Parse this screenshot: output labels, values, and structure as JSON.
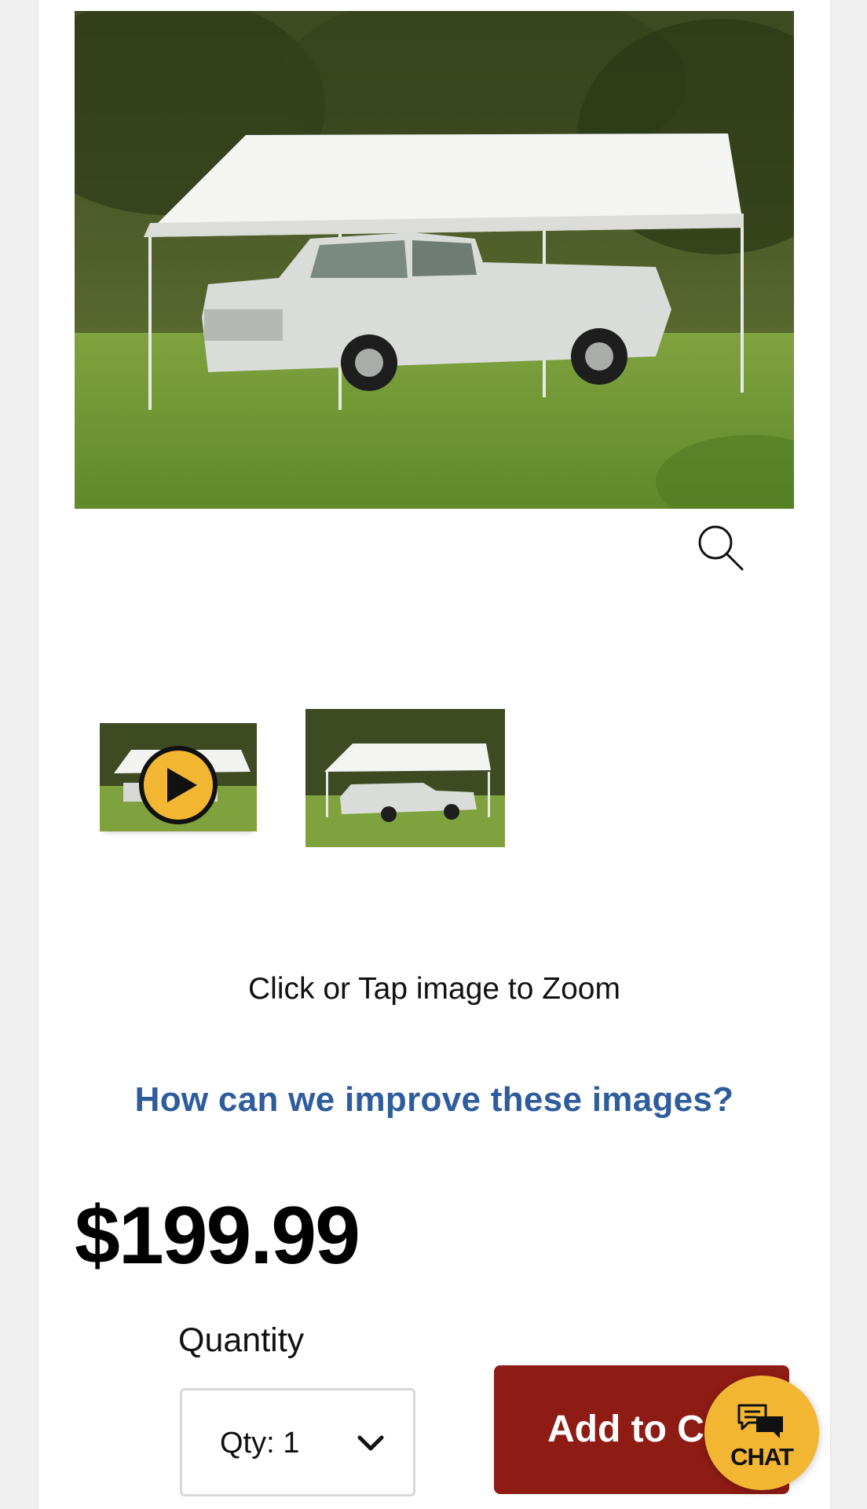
{
  "product": {
    "main_image_alt": "White canopy carport sheltering a silver pickup truck on a lawn",
    "thumbnails": [
      {
        "kind": "video",
        "alt": "Canopy video thumbnail"
      },
      {
        "kind": "image",
        "alt": "Canopy with pickup truck thumbnail"
      }
    ]
  },
  "gallery": {
    "zoom_hint": "Click or Tap image to Zoom",
    "improve_link": "How can we improve these images?"
  },
  "pricing": {
    "price": "$199.99"
  },
  "purchase": {
    "quantity_label": "Quantity",
    "quantity_value": "Qty: 1",
    "add_to_cart_label": "Add to Cart"
  },
  "chat": {
    "label": "CHAT"
  },
  "icons": {
    "zoom": "magnifier-icon",
    "play": "play-icon",
    "chevron": "chevron-down-icon",
    "chat": "chat-bubbles-icon"
  },
  "colors": {
    "link": "#2f5d9c",
    "cart_button": "#8e1c14",
    "chat_button": "#f3b633",
    "play_button": "#f3b633"
  }
}
